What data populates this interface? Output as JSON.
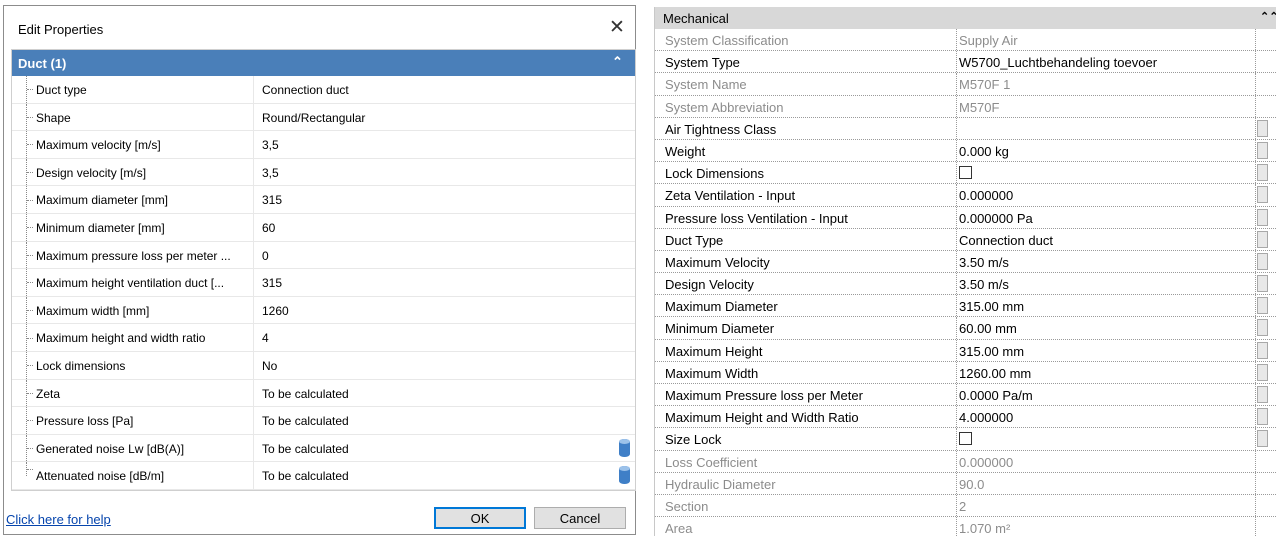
{
  "dialog": {
    "title": "Edit Properties",
    "group_label": "Duct (1)",
    "rows": [
      {
        "name": "Duct type",
        "value": "Connection duct"
      },
      {
        "name": "Shape",
        "value": "Round/Rectangular"
      },
      {
        "name": "Maximum velocity [m/s]",
        "value": "3,5"
      },
      {
        "name": "Design velocity [m/s]",
        "value": "3,5"
      },
      {
        "name": "Maximum diameter [mm]",
        "value": "315"
      },
      {
        "name": "Minimum diameter [mm]",
        "value": "60"
      },
      {
        "name": "Maximum pressure loss per meter ...",
        "value": "0"
      },
      {
        "name": "Maximum height ventilation duct [...",
        "value": "315"
      },
      {
        "name": "Maximum width [mm]",
        "value": "1260"
      },
      {
        "name": "Maximum height and width ratio",
        "value": "4"
      },
      {
        "name": "Lock dimensions",
        "value": "No"
      },
      {
        "name": "Zeta",
        "value": "To be calculated"
      },
      {
        "name": "Pressure loss [Pa]",
        "value": "To be calculated"
      },
      {
        "name": "Generated noise Lw [dB(A)]",
        "value": "To be calculated",
        "icon": "database-icon"
      },
      {
        "name": "Attenuated noise [dB/m]",
        "value": "To be calculated",
        "icon": "database-icon"
      }
    ],
    "help_link": "Click here for help",
    "ok_label": "OK",
    "cancel_label": "Cancel",
    "accent_color": "#4a7fb9"
  },
  "revit": {
    "section_label": "Mechanical",
    "rows": [
      {
        "name": "System Classification",
        "value": "Supply Air",
        "disabled": true
      },
      {
        "name": "System Type",
        "value": "W5700_Luchtbehandeling toevoer"
      },
      {
        "name": "System Name",
        "value": "M570F 1",
        "disabled": true
      },
      {
        "name": "System Abbreviation",
        "value": "M570F",
        "disabled": true
      },
      {
        "name": "Air Tightness Class",
        "value": "",
        "button": true
      },
      {
        "name": "Weight",
        "value": "0.000 kg",
        "button": true
      },
      {
        "name": "Lock Dimensions",
        "value": "",
        "checkbox": true,
        "button": true
      },
      {
        "name": "Zeta Ventilation - Input",
        "value": "0.000000",
        "button": true
      },
      {
        "name": "Pressure loss Ventilation - Input",
        "value": "0.000000 Pa",
        "button": true
      },
      {
        "name": "Duct Type",
        "value": "Connection duct",
        "button": true
      },
      {
        "name": "Maximum Velocity",
        "value": "3.50 m/s",
        "button": true
      },
      {
        "name": "Design Velocity",
        "value": "3.50 m/s",
        "button": true
      },
      {
        "name": "Maximum Diameter",
        "value": "315.00 mm",
        "button": true
      },
      {
        "name": "Minimum Diameter",
        "value": "60.00 mm",
        "button": true
      },
      {
        "name": "Maximum Height",
        "value": "315.00 mm",
        "button": true
      },
      {
        "name": "Maximum Width",
        "value": "1260.00 mm",
        "button": true
      },
      {
        "name": "Maximum Pressure loss per Meter",
        "value": "0.0000 Pa/m",
        "button": true
      },
      {
        "name": "Maximum Height and Width Ratio",
        "value": "4.000000",
        "button": true
      },
      {
        "name": "Size Lock",
        "value": "",
        "checkbox": true,
        "button": true
      },
      {
        "name": "Loss Coefficient",
        "value": "0.000000",
        "disabled": true
      },
      {
        "name": "Hydraulic Diameter",
        "value": "90.0",
        "disabled": true
      },
      {
        "name": "Section",
        "value": "2",
        "disabled": true
      },
      {
        "name": "Area",
        "value": "1.070 m²",
        "disabled": true
      }
    ]
  }
}
